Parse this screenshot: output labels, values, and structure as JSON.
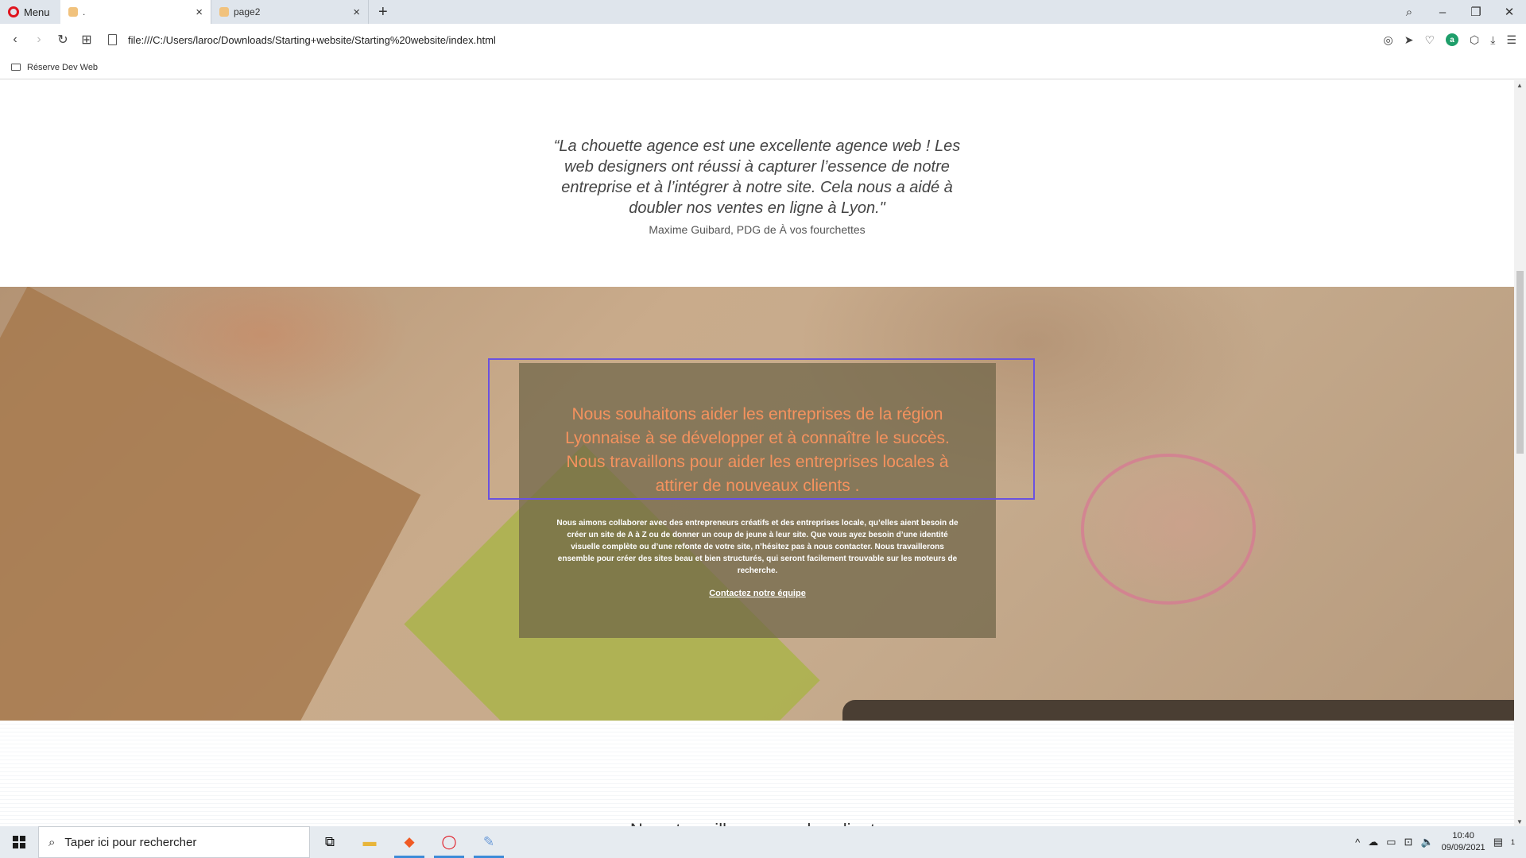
{
  "browser": {
    "menu_label": "Menu",
    "tabs": [
      {
        "title": "."
      },
      {
        "title": "page2"
      }
    ],
    "new_tab": "+",
    "url": "file:///C:/Users/laroc/Downloads/Starting+website/Starting%20website/index.html",
    "bookmark_folder": "Réserve Dev Web"
  },
  "page": {
    "testimonial": {
      "quote": "“La chouette agence est une excellente agence web ! Les web designers ont réussi à capturer l’essence de notre entreprise et à l’intégrer à notre site. Cela nous a aidé à doubler nos ventes en ligne à Lyon.\"",
      "author": "Maxime Guibard, PDG de À vos fourchettes"
    },
    "hero": {
      "lead": "Nous souhaitons aider les entreprises de la région Lyonnaise à se développer et à connaître le succès. Nous travaillons pour aider les entreprises locales à attirer de nouveaux clients .",
      "body": "Nous aimons collaborer avec des entrepreneurs créatifs et des entreprises locale, qu’elles aient besoin de créer un site de A à Z ou de donner un coup de jeune à leur site. Que vous ayez besoin d’une identité visuelle complète ou d’une refonte de votre site, n’hésitez pas à nous contacter. Nous travaillerons ensemble pour créer des sites beau et bien structurés, qui seront facilement trouvable sur les moteurs de recherche.",
      "cta": "Contactez notre équipe"
    },
    "next_heading": "Nous travaillons avec des clients"
  },
  "taskbar": {
    "search_placeholder": "Taper ici pour rechercher",
    "time": "10:40",
    "date": "09/09/2021",
    "notification_count": "1"
  },
  "colors": {
    "lead_text": "#f5925e",
    "highlight_border": "#6a52e0",
    "overlay": "#6e6446"
  }
}
